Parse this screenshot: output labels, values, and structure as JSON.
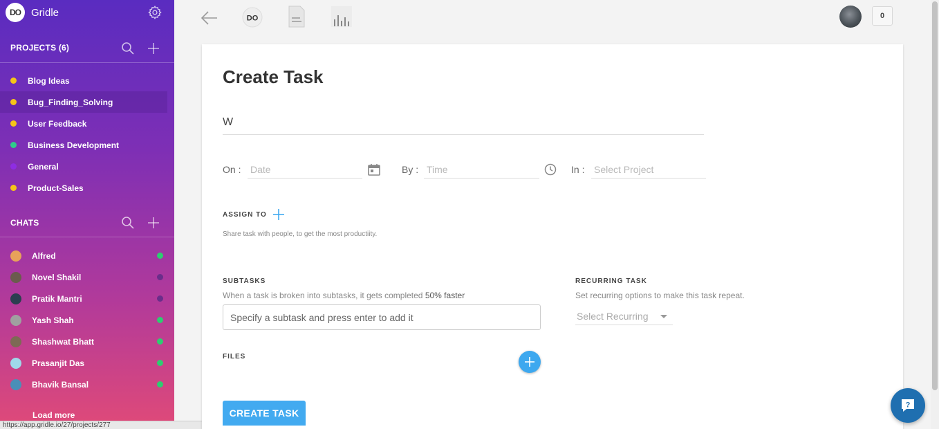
{
  "app": {
    "name": "Gridle",
    "logo_text": "DO"
  },
  "sidebar": {
    "projects_heading": "PROJECTS (6)",
    "projects": [
      {
        "label": "Blog Ideas",
        "color": "#f5c518"
      },
      {
        "label": "Bug_Finding_Solving",
        "color": "#f5c518"
      },
      {
        "label": "User Feedback",
        "color": "#f5c518"
      },
      {
        "label": "Business Development",
        "color": "#2ecc8a"
      },
      {
        "label": "General",
        "color": "#8e2de2"
      },
      {
        "label": "Product-Sales",
        "color": "#f5c518"
      }
    ],
    "chats_heading": "CHATS",
    "chats": [
      {
        "label": "Alfred",
        "online": true,
        "avatar_color": "#e8a25a"
      },
      {
        "label": "Novel Shakil",
        "online": false,
        "avatar_color": "#6b5b4d"
      },
      {
        "label": "Pratik Mantri",
        "online": false,
        "avatar_color": "#2c3e50"
      },
      {
        "label": "Yash Shah",
        "online": true,
        "avatar_color": "#a0a0a0"
      },
      {
        "label": "Shashwat Bhatt",
        "online": true,
        "avatar_color": "#7d6a55"
      },
      {
        "label": "Prasanjit Das",
        "online": true,
        "avatar_color": "#9fd8ea"
      },
      {
        "label": "Bhavik Bansal",
        "online": true,
        "avatar_color": "#4a8fb8"
      }
    ],
    "load_more": "Load more",
    "status_url": "https://app.gridle.io/27/projects/277"
  },
  "topbar": {
    "notification_count": "0"
  },
  "form": {
    "title": "Create Task",
    "task_value": "W",
    "on_label": "On :",
    "date_placeholder": "Date",
    "by_label": "By :",
    "time_placeholder": "Time",
    "in_label": "In :",
    "project_placeholder": "Select Project",
    "assign_label": "ASSIGN TO",
    "assign_hint": "Share task with people, to get the most productiity.",
    "subtasks_label": "SUBTASKS",
    "subtasks_desc": "When a task is broken into subtasks, it gets completed",
    "subtasks_desc_bold": "50% faster",
    "subtask_placeholder": "Specify a subtask and press enter to add it",
    "recurring_label": "RECURRING TASK",
    "recurring_desc": "Set recurring options to make this task repeat.",
    "recurring_value": "Select Recurring",
    "files_label": "FILES",
    "create_button": "CREATE TASK"
  },
  "colors": {
    "accent": "#42aaf0",
    "online": "#2ecc71",
    "offline": "#6a2d8a"
  }
}
